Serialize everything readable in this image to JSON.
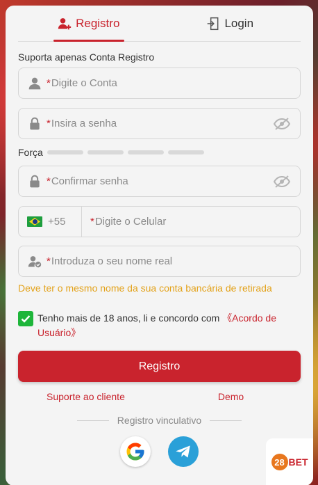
{
  "tabs": {
    "register_label": "Registro",
    "login_label": "Login"
  },
  "form": {
    "note": "Suporta apenas Conta Registro",
    "required_mark": "*",
    "account_placeholder": "Digite o Conta",
    "password_placeholder": "Insira a senha",
    "strength_label": "Força",
    "confirm_placeholder": "Confirmar senha",
    "phone_code": "+55",
    "phone_placeholder": "Digite o Celular",
    "realname_placeholder": "Introduza o seu nome real",
    "realname_hint": "Deve ter o mesmo nome da sua conta bancária de retirada",
    "agree_text": "Tenho mais de 18 anos, li e concordo com ",
    "agree_link": "《Acordo de Usuário》",
    "agree_checked": true,
    "submit_label": "Registro"
  },
  "links": {
    "support": "Suporte ao cliente",
    "demo": "Demo"
  },
  "social": {
    "divider_label": "Registro vinculativo",
    "icons": [
      "google-icon",
      "telegram-icon"
    ]
  },
  "logo": {
    "number": "28",
    "brand": "BET"
  },
  "colors": {
    "accent": "#c9232d",
    "hint": "#e3a21a",
    "checkbox": "#1eb53a",
    "telegram": "#2aa0d8"
  }
}
